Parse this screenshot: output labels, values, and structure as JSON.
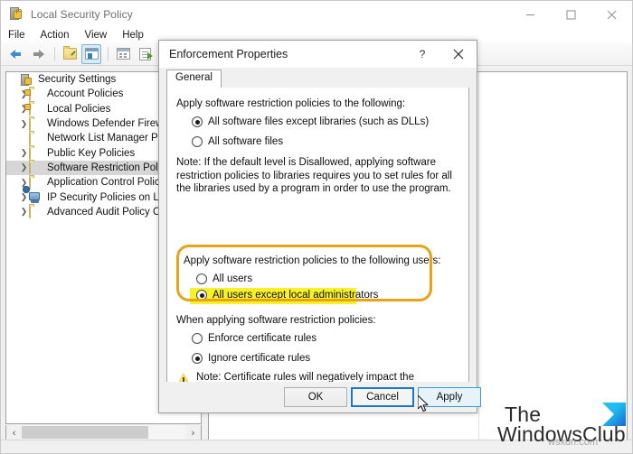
{
  "main_window": {
    "title": "Local Security Policy",
    "title_icon": "security-policy-icon",
    "controls": {
      "minimize": "minimize-icon",
      "maximize": "maximize-icon",
      "close": "close-icon"
    },
    "menu": [
      "File",
      "Action",
      "View",
      "Help"
    ],
    "toolbar": [
      {
        "name": "back-button",
        "icon": "arrow-left-icon"
      },
      {
        "name": "forward-button",
        "icon": "arrow-right-icon"
      },
      {
        "name": "up-folder-button",
        "icon": "folder-up-icon"
      },
      {
        "name": "show-hide-console-tree-button",
        "icon": "console-tree-icon",
        "active": true
      },
      {
        "name": "properties-button",
        "icon": "properties-icon"
      },
      {
        "name": "export-list-button",
        "icon": "export-list-icon"
      },
      {
        "name": "help-button",
        "icon": "help-icon"
      }
    ],
    "tree": [
      {
        "label": "Security Settings",
        "icon": "security-settings-icon",
        "level": 0,
        "expandable": false,
        "selected": false
      },
      {
        "label": "Account Policies",
        "icon": "folder-locked-icon",
        "level": 1,
        "expandable": true,
        "selected": false
      },
      {
        "label": "Local Policies",
        "icon": "folder-locked-icon",
        "level": 1,
        "expandable": true,
        "selected": false
      },
      {
        "label": "Windows Defender Firewall",
        "icon": "folder-icon",
        "level": 1,
        "expandable": true,
        "selected": false
      },
      {
        "label": "Network List Manager Polic",
        "icon": "folder-icon",
        "level": 1,
        "expandable": false,
        "selected": false
      },
      {
        "label": "Public Key Policies",
        "icon": "folder-icon",
        "level": 1,
        "expandable": true,
        "selected": false
      },
      {
        "label": "Software Restriction Policie",
        "icon": "folder-icon",
        "level": 1,
        "expandable": true,
        "selected": true
      },
      {
        "label": "Application Control Policies",
        "icon": "folder-icon",
        "level": 1,
        "expandable": true,
        "selected": false
      },
      {
        "label": "IP Security Policies on Loca",
        "icon": "ip-security-icon",
        "level": 1,
        "expandable": true,
        "selected": false
      },
      {
        "label": "Advanced Audit Policy Con",
        "icon": "folder-icon",
        "level": 1,
        "expandable": true,
        "selected": false
      }
    ],
    "hscroll": {
      "left_arrow": "‹",
      "right_arrow": "›"
    }
  },
  "dialog": {
    "title": "Enforcement Properties",
    "help_button": "?",
    "close_button": "×",
    "tabs": [
      {
        "label": "General",
        "selected": true
      }
    ],
    "group1": {
      "label": "Apply software restriction policies to the following:",
      "options": [
        {
          "label": "All software files except libraries (such as DLLs)",
          "checked": true
        },
        {
          "label": "All software files",
          "checked": false
        }
      ],
      "note": "Note:  If the default level is Disallowed, applying software restriction policies to libraries requires you to set rules for all the libraries used by a program in order to use the program."
    },
    "group2": {
      "label": "Apply software restriction policies to the following users:",
      "options": [
        {
          "label": "All users",
          "checked": false
        },
        {
          "label": "All users except local administrators",
          "checked": true,
          "highlighted": true
        }
      ],
      "highlight_color": "#e8a317",
      "marker_color": "#f7f12a"
    },
    "group3": {
      "label": "When applying software restriction policies:",
      "options": [
        {
          "label": "Enforce certificate rules",
          "checked": false
        },
        {
          "label": "Ignore certificate rules",
          "checked": true
        }
      ],
      "warning_icon": "warning-triangle-icon",
      "note": "Note:  Certificate rules will negatively impact the performance of your machine."
    },
    "buttons": [
      {
        "label": "OK",
        "name": "ok-button",
        "style": "normal"
      },
      {
        "label": "Cancel",
        "name": "cancel-button",
        "style": "default"
      },
      {
        "label": "Apply",
        "name": "apply-button",
        "style": "hover"
      }
    ]
  },
  "watermark": {
    "line1": "The",
    "line2": "WindowsClub",
    "sub": "wsxdn.com",
    "logo": "windowsclub-logo"
  }
}
